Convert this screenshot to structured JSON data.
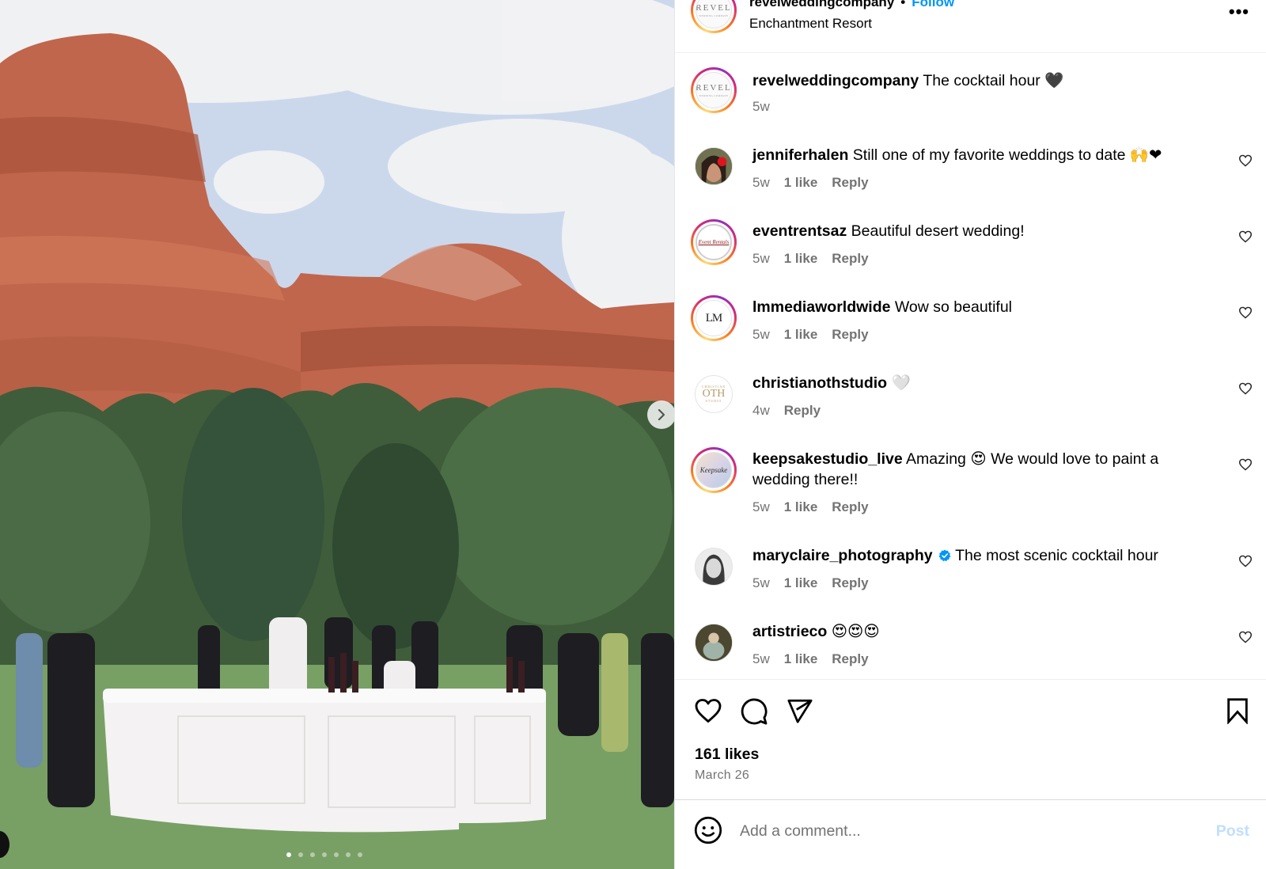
{
  "media": {
    "alt": "Outdoor cocktail hour at a wedding beneath red rock cliffs, with a white round bar and guests on the lawn",
    "carousel": {
      "total_slides": 7,
      "active_slide": 1
    },
    "next_button_label": "Next",
    "colors": {
      "sky": "#c9d6ea",
      "rock": "#b9634a",
      "trees": "#3e5c3a",
      "grass": "#6e9a5c"
    }
  },
  "header": {
    "username": "revelweddingcompany",
    "separator": "•",
    "follow_label": "Follow",
    "location": "Enchantment Resort",
    "more_label": "•••",
    "avatar_text": "REVEL",
    "avatar_subtext": "WEDDING COMPANY"
  },
  "caption": {
    "username": "revelweddingcompany",
    "text": "The cocktail hour",
    "emoji": "🖤",
    "time": "5w"
  },
  "comments": [
    {
      "username": "jenniferhalen",
      "text": "Still one of my favorite weddings to date",
      "emoji": "🙌❤",
      "time": "5w",
      "likes": "1 like",
      "reply": "Reply",
      "avatar": "photo-woman-red-flower",
      "story_ring": false,
      "verified": false
    },
    {
      "username": "eventrentsaz",
      "text": "Beautiful desert wedding!",
      "emoji": "",
      "time": "5w",
      "likes": "1 like",
      "reply": "Reply",
      "avatar": "event-rentals-logo",
      "story_ring": true,
      "verified": false
    },
    {
      "username": "lmmediaworldwide",
      "text": "Wow so beautiful",
      "emoji": "",
      "time": "5w",
      "likes": "1 like",
      "reply": "Reply",
      "avatar": "lm-monogram-logo",
      "story_ring": true,
      "verified": false
    },
    {
      "username": "christianothstudio",
      "text": "",
      "emoji": "🤍",
      "time": "4w",
      "likes": "",
      "reply": "Reply",
      "avatar": "christian-oth-logo",
      "story_ring": false,
      "verified": false
    },
    {
      "username": "keepsakestudio_live",
      "text": "Amazing",
      "emoji": "😍",
      "text2": "We would love to paint a wedding there!!",
      "time": "5w",
      "likes": "1 like",
      "reply": "Reply",
      "avatar": "keepsake-logo",
      "story_ring": true,
      "verified": false
    },
    {
      "username": "maryclaire_photography",
      "text": "The most scenic cocktail hour",
      "emoji": "",
      "time": "5w",
      "likes": "1 like",
      "reply": "Reply",
      "avatar": "photo-woman-bw",
      "story_ring": false,
      "verified": true
    },
    {
      "username": "artistrieco",
      "text": "",
      "emoji": "😍😍😍",
      "time": "5w",
      "likes": "1 like",
      "reply": "Reply",
      "avatar": "photo-person-sitting",
      "story_ring": false,
      "verified": false
    }
  ],
  "logos": {
    "event_rentals": "Event Rentals",
    "lm": "LM",
    "oth_top": "CHRISTIAN",
    "oth_main": "OTH",
    "oth_bottom": "STUDIO",
    "keepsake": "Keepsake"
  },
  "actions": {
    "like_label": "Like",
    "comment_label": "Comment",
    "share_label": "Share",
    "save_label": "Save",
    "likes_count": "161 likes",
    "date": "March 26"
  },
  "add_comment": {
    "placeholder": "Add a comment...",
    "value": "",
    "post_label": "Post"
  },
  "colors": {
    "accent": "#0095f6",
    "muted_text": "#737373",
    "post_disabled": "#c0dffd",
    "verified": "#0095f6"
  }
}
